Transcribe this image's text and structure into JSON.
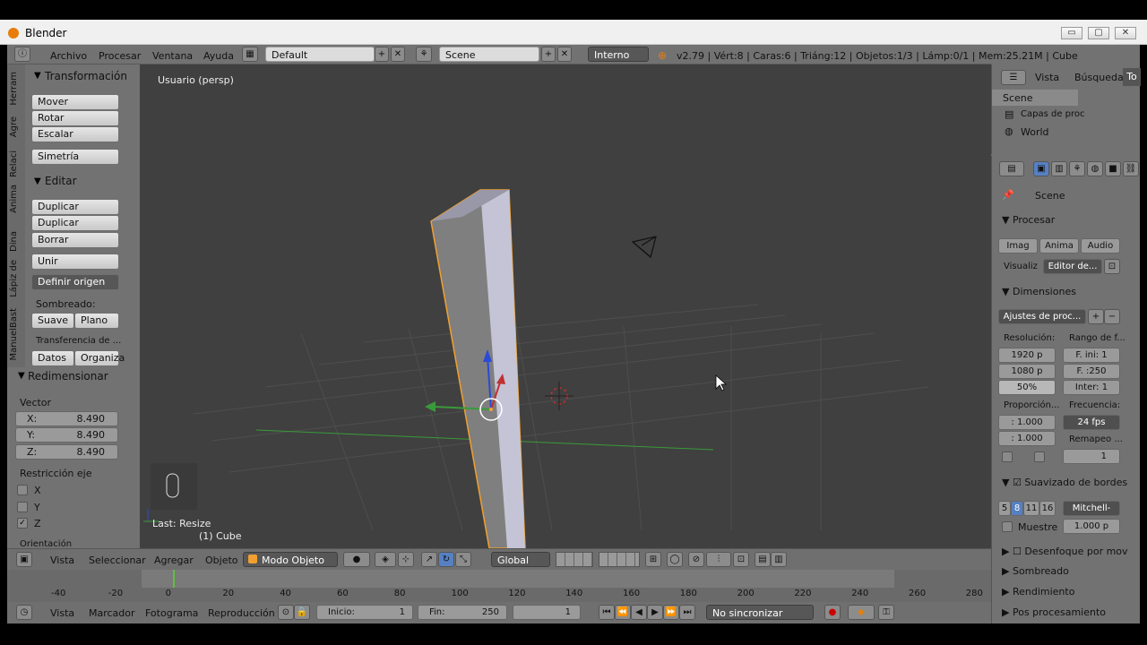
{
  "window": {
    "title": "Blender",
    "btn_min": "▭",
    "btn_max": "▢",
    "btn_close": "✕"
  },
  "infobar": {
    "menus": [
      "Archivo",
      "Procesar",
      "Ventana",
      "Ayuda"
    ],
    "layout": "Default",
    "scene": "Scene",
    "engine": "Interno",
    "stats": "v2.79 | Vért:8 | Caras:6 | Triáng:12 | Objetos:1/3 | Lámp:0/1 | Mem:25.21M | Cube"
  },
  "tabs": [
    "Herram",
    "Agre",
    "Relaci",
    "Anima",
    "Dina",
    "Lápiz de",
    "ManuelBast"
  ],
  "toolshelf": {
    "transform_header": "Transformación",
    "move": "Mover",
    "rotate": "Rotar",
    "scale": "Escalar",
    "mirror": "Simetría",
    "edit_header": "Editar",
    "duplicate": "Duplicar",
    "duplicate_linked": "Duplicar vinculado",
    "delete": "Borrar",
    "join": "Unir",
    "set_origin": "Definir origen",
    "shading_label": "Sombreado:",
    "smooth": "Suave",
    "flat": "Plano",
    "data_transfer": "Transferencia de ...",
    "data": "Datos",
    "organize": "Organiza",
    "resize_header": "Redimensionar",
    "vector_label": "Vector",
    "vector": [
      {
        "axis": "X:",
        "value": "8.490"
      },
      {
        "axis": "Y:",
        "value": "8.490"
      },
      {
        "axis": "Z:",
        "value": "8.490"
      }
    ],
    "constraint_label": "Restricción eje",
    "axes": [
      "X",
      "Y",
      "Z"
    ],
    "orientation": "Orientación"
  },
  "viewport": {
    "label": "Usuario (persp)",
    "last_op": "Last: Resize",
    "object": "(1) Cube"
  },
  "header3d": {
    "menus": [
      "Vista",
      "Seleccionar",
      "Agregar",
      "Objeto"
    ],
    "mode": "Modo Objeto",
    "orientation": "Global"
  },
  "timeline": {
    "ticks": [
      "-40",
      "-20",
      "0",
      "20",
      "40",
      "60",
      "80",
      "100",
      "120",
      "140",
      "160",
      "180",
      "200",
      "220",
      "240",
      "260",
      "280"
    ],
    "current_frame": 0
  },
  "tlheader": {
    "menus": [
      "Vista",
      "Marcador",
      "Fotograma",
      "Reproducción"
    ],
    "start_label": "Inicio:",
    "start": "1",
    "end_label": "Fin:",
    "end": "250",
    "frame": "1",
    "sync": "No sincronizar"
  },
  "outliner": {
    "menus": [
      "Vista",
      "Búsqueda",
      "To"
    ],
    "items": [
      "Scene",
      "Capas de proc",
      "World"
    ]
  },
  "props": {
    "scene": "Scene",
    "render_header": "Procesar",
    "img": "Imag",
    "anim": "Anima",
    "audio": "Audio",
    "display_label": "Visualiz",
    "display_value": "Editor de...",
    "dim_header": "Dimensiones",
    "preset": "Ajustes de proc...",
    "res_label": "Resolución:",
    "range_label": "Rango de f...",
    "res_x": "1920 p",
    "res_y": "1080 p",
    "res_pct": "50%",
    "f_start": "F. ini: 1",
    "f_end": "F. :250",
    "f_step": "Inter: 1",
    "aspect_label": "Proporción...",
    "fps_label": "Frecuencia:",
    "aspect_x": ": 1.000",
    "aspect_y": ": 1.000",
    "fps": "24 fps",
    "remap_label": "Remapeo ...",
    "remap": "1",
    "aa_header": "Suavizado de bordes",
    "aa_levels": [
      "5",
      "8",
      "11",
      "16"
    ],
    "aa_filter": "Mitchell-",
    "full_sample": "Muestre",
    "aa_size": "1.000 p",
    "sections": [
      "Desenfoque por mov",
      "Sombreado",
      "Rendimiento",
      "Pos procesamiento"
    ]
  },
  "colors": {
    "selected_outline": "#f0a030",
    "axis_x": "#c03030",
    "axis_y": "#3a9a3a",
    "axis_z": "#2a4ad8"
  }
}
